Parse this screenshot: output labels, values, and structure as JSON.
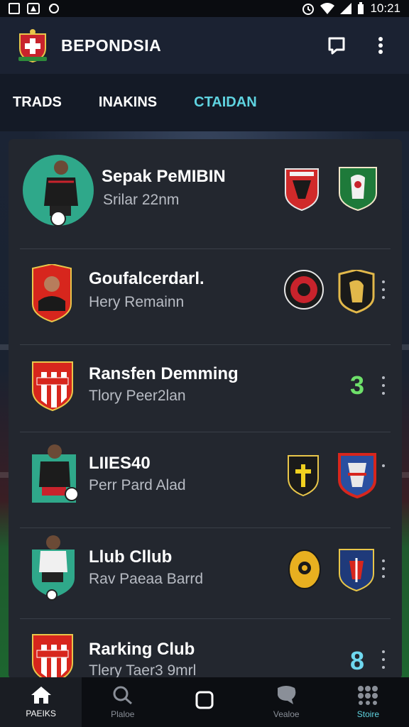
{
  "status_bar": {
    "time": "10:21"
  },
  "app": {
    "title": "BEPONDSIA"
  },
  "tabs": [
    {
      "label": "TRADS",
      "active": false
    },
    {
      "label": "INAKINS",
      "active": false
    },
    {
      "label": "CTAIDAN",
      "active": true
    }
  ],
  "list": [
    {
      "name": "Sepak PeMIBIN",
      "subtitle": "Srilar 22nm",
      "count": ""
    },
    {
      "name": "Goufalcerdarl.",
      "subtitle": "Hery Remainn",
      "count": ""
    },
    {
      "name": "Ransfen Demming",
      "subtitle": "Tlory Peer2lan",
      "count": "3"
    },
    {
      "name": "LIIES40",
      "subtitle": "Perr Pard Alad",
      "count": ""
    },
    {
      "name": "Llub Cllub",
      "subtitle": "Rav Paeaa Barrd",
      "count": ""
    },
    {
      "name": "Rarking Club",
      "subtitle": "Tlery Taer3 9mrl",
      "count": "8"
    }
  ],
  "bottom_nav": [
    {
      "label": "PAEIKS",
      "icon": "home-icon",
      "active": true
    },
    {
      "label": "Plaloe",
      "icon": "search-icon",
      "active": false
    },
    {
      "label": "",
      "icon": "square-icon",
      "active": false
    },
    {
      "label": "Vealoe",
      "icon": "chat-icon",
      "active": false
    },
    {
      "label": "Stoire",
      "icon": "grid-icon",
      "active": false,
      "accent": true
    }
  ],
  "colors": {
    "accent": "#5fd3e0",
    "count_green": "#6ee06a",
    "count_blue": "#6fd8ef",
    "card": "#23272f",
    "appbar": "#1b2232"
  }
}
